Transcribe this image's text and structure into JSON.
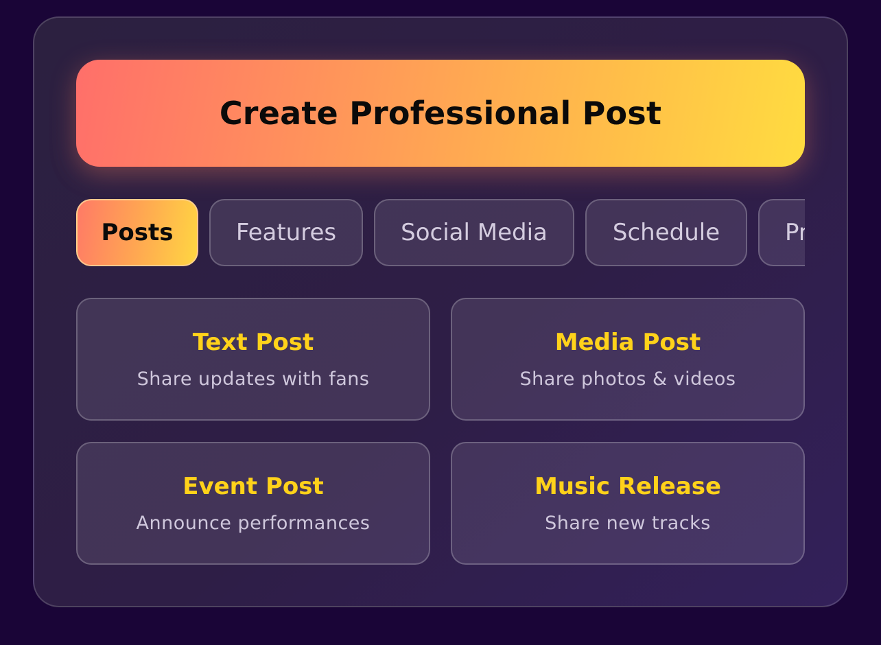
{
  "header": {
    "create_label": "Create Professional Post"
  },
  "tabs": [
    {
      "label": "Posts",
      "active": true
    },
    {
      "label": "Features",
      "active": false
    },
    {
      "label": "Social Media",
      "active": false
    },
    {
      "label": "Schedule",
      "active": false
    },
    {
      "label": "Pr",
      "active": false
    }
  ],
  "cards": [
    {
      "title": "Text Post",
      "description": "Share updates with fans"
    },
    {
      "title": "Media Post",
      "description": "Share photos & videos"
    },
    {
      "title": "Event Post",
      "description": "Announce performances"
    },
    {
      "title": "Music Release",
      "description": "Share new tracks"
    }
  ],
  "colors": {
    "background": "#1a0537",
    "accent_start": "#ff6f6a",
    "accent_end": "#ffdc40",
    "card_title": "#ffd21a"
  }
}
